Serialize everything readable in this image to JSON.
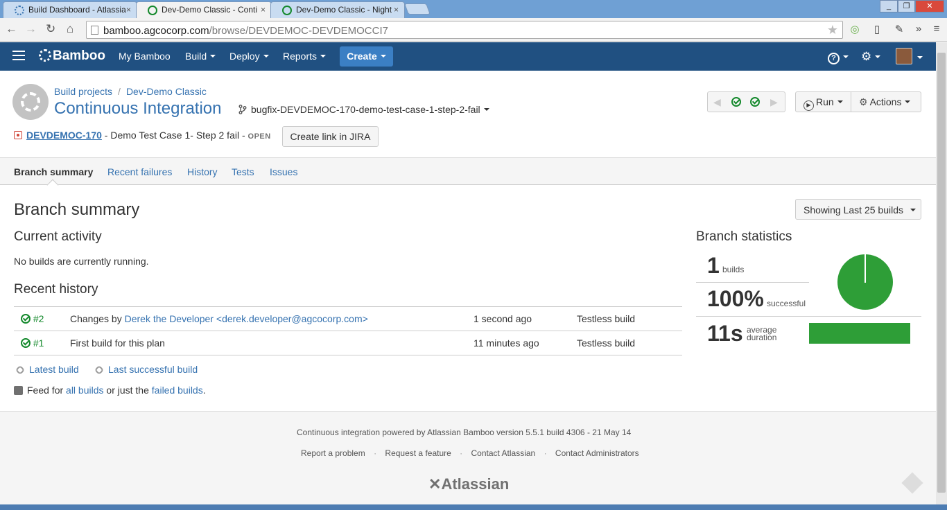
{
  "browser": {
    "tabs": [
      {
        "title": "Build Dashboard - Atlassia",
        "active": false
      },
      {
        "title": "Dev-Demo Classic - Conti",
        "active": true
      },
      {
        "title": "Dev-Demo Classic - Night",
        "active": false
      }
    ],
    "tab_close": "×",
    "url_host": "bamboo.agcocorp.com",
    "url_path": "/browse/DEVDEMOC-DEVDEMOCCI7",
    "win_min": "_",
    "win_max": "❐",
    "win_close": "✕"
  },
  "header": {
    "logo_text": "Bamboo",
    "nav": [
      "My Bamboo",
      "Build",
      "Deploy",
      "Reports"
    ],
    "create_label": "Create",
    "help_icon": "?",
    "gear_icon": "⚙",
    "brand_color": "#205081"
  },
  "plan": {
    "breadcrumb": [
      "Build projects",
      "Dev-Demo Classic"
    ],
    "title": "Continuous Integration",
    "branch": "bugfix-DEVDEMOC-170-demo-test-case-1-step-2-fail",
    "run_label": "Run",
    "actions_label": "Actions",
    "issue_key": "DEVDEMOC-170",
    "issue_summary": " - Demo Test Case 1- Step 2 fail - ",
    "issue_status": "OPEN",
    "jira_button": "Create link in JIRA"
  },
  "tabs": [
    "Branch summary",
    "Recent failures",
    "History",
    "Tests",
    "Issues"
  ],
  "summary": {
    "heading": "Branch summary",
    "showing_label": "Showing Last 25 builds",
    "current_activity_heading": "Current activity",
    "current_activity_text": "No builds are currently running.",
    "recent_history_heading": "Recent history",
    "history": [
      {
        "number": "#2",
        "prefix": "Changes by ",
        "author": "Derek the Developer <derek.developer@agcocorp.com>",
        "time": "1 second ago",
        "result": "Testless build"
      },
      {
        "number": "#1",
        "prefix": "First build for this plan",
        "author": "",
        "time": "11 minutes ago",
        "result": "Testless build"
      }
    ],
    "latest_build_link": "Latest build",
    "last_successful_link": "Last successful build",
    "feed_prefix": "Feed for ",
    "feed_all": "all builds",
    "feed_middle": " or just the ",
    "feed_failed": "failed builds",
    "feed_end": "."
  },
  "stats": {
    "heading": "Branch statistics",
    "builds_value": "1",
    "builds_label": "builds",
    "success_value": "100%",
    "success_label": "successful",
    "duration_value": "11s",
    "duration_label_1": "average",
    "duration_label_2": "duration",
    "success_fraction": 1.0,
    "success_color": "#2e9e37"
  },
  "footer": {
    "powered_by": "Continuous integration powered by Atlassian Bamboo version 5.5.1 build 4306 - 21 May 14",
    "links": [
      "Report a problem",
      "Request a feature",
      "Contact Atlassian",
      "Contact Administrators"
    ],
    "separator": "·",
    "brand": "Atlassian"
  }
}
